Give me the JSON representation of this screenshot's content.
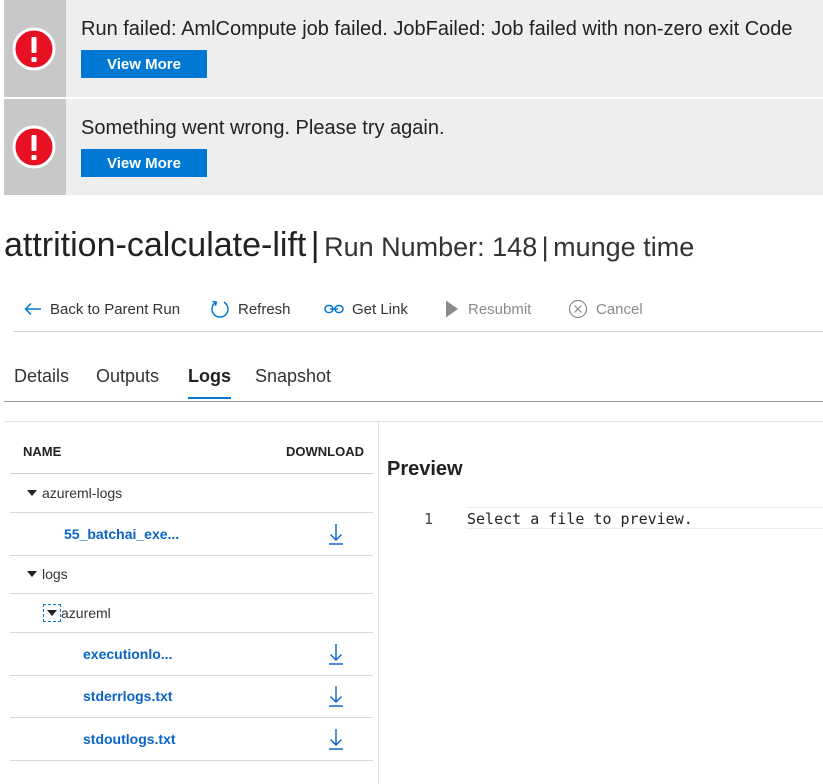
{
  "alerts": [
    {
      "message": "Run failed: AmlCompute job failed. JobFailed: Job failed with non-zero exit Code",
      "button": "View More",
      "icon": "error-icon"
    },
    {
      "message": "Something went wrong. Please try again.",
      "button": "View More",
      "icon": "error-icon"
    }
  ],
  "title": {
    "main": "attrition-calculate-lift",
    "separator": "|",
    "run_number": "Run Number: 148",
    "separator2": "|",
    "run_name": "munge time"
  },
  "toolbar": {
    "back": "Back to Parent Run",
    "refresh": "Refresh",
    "get_link": "Get Link",
    "resubmit": "Resubmit",
    "cancel": "Cancel"
  },
  "tabs": [
    "Details",
    "Outputs",
    "Logs",
    "Snapshot"
  ],
  "active_tab": "Logs",
  "tree": {
    "header_name": "NAME",
    "header_download": "DOWNLOAD",
    "rows": [
      {
        "label": "azureml-logs",
        "type": "folder"
      },
      {
        "label": "55_batchai_exe...",
        "type": "file"
      },
      {
        "label": "logs",
        "type": "folder"
      },
      {
        "label": "azureml",
        "type": "folder"
      },
      {
        "label": "executionlo...",
        "type": "file"
      },
      {
        "label": "stderrlogs.txt",
        "type": "file"
      },
      {
        "label": "stdoutlogs.txt",
        "type": "file"
      }
    ]
  },
  "preview": {
    "title": "Preview",
    "line_number": "1",
    "line_text": "Select a file to preview."
  },
  "colors": {
    "accent": "#0078d4",
    "link": "#0a64c8",
    "error": "#e81123",
    "alert_bg": "#eeeeee"
  }
}
